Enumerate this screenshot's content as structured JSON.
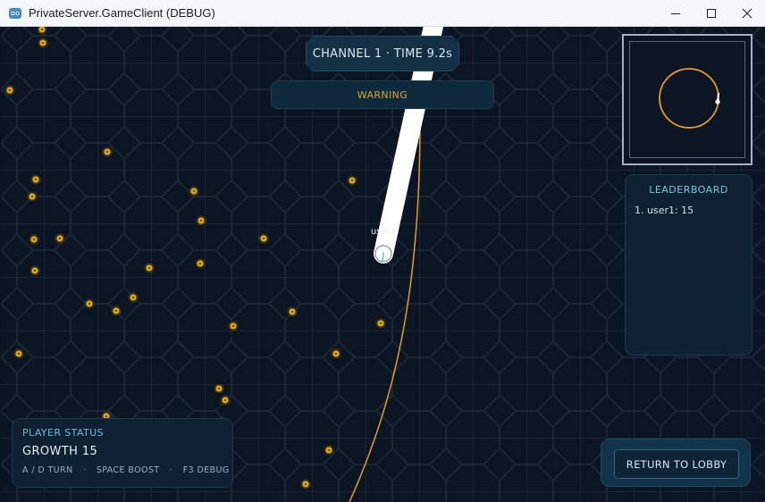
{
  "window": {
    "title": "PrivateServer.GameClient (DEBUG)",
    "controls": [
      "minimize",
      "maximize",
      "close"
    ]
  },
  "hud": {
    "channel_time": "CHANNEL 1 · TIME 9.2s",
    "warning": "WARNING"
  },
  "player": {
    "name": "user1",
    "head_color": "#ffffff",
    "tail_color": "#e89a2a"
  },
  "leaderboard": {
    "title": "LEADERBOARD",
    "entries": [
      "1. user1: 15"
    ]
  },
  "status": {
    "title": "PLAYER STATUS",
    "growth": "GROWTH 15",
    "hints": [
      "A / D TURN",
      "SPACE BOOST",
      "F3 DEBUG"
    ]
  },
  "actions": {
    "return_label": "RETURN TO LOBBY"
  },
  "colors": {
    "background": "#0c1524",
    "grid": "#1c2838",
    "food": "#e2b11f",
    "accent": "#7ec3da",
    "warning": "#d4a542"
  }
}
